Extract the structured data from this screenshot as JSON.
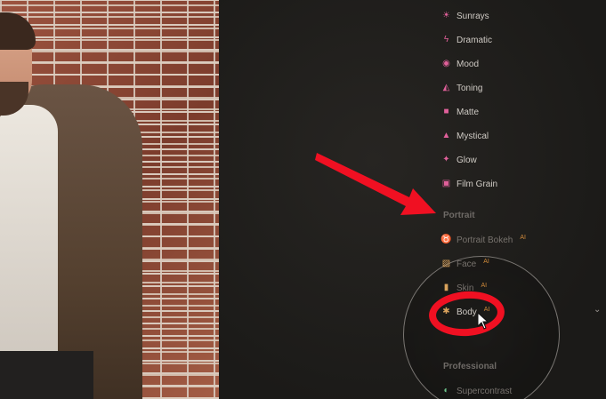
{
  "menu": {
    "items_top": [
      {
        "label": "Sunrays",
        "icon": "sunrays-icon",
        "color": "#e0609a"
      },
      {
        "label": "Dramatic",
        "icon": "dramatic-icon",
        "color": "#e0609a"
      },
      {
        "label": "Mood",
        "icon": "mood-icon",
        "color": "#e0609a"
      },
      {
        "label": "Toning",
        "icon": "toning-icon",
        "color": "#e0609a"
      },
      {
        "label": "Matte",
        "icon": "matte-icon",
        "color": "#e0609a"
      },
      {
        "label": "Mystical",
        "icon": "mystical-icon",
        "color": "#e0609a"
      },
      {
        "label": "Glow",
        "icon": "glow-icon",
        "color": "#e0609a"
      },
      {
        "label": "Film Grain",
        "icon": "film-grain-icon",
        "color": "#e0609a"
      }
    ],
    "portrait_section": "Portrait",
    "portrait_items": [
      {
        "label": "Portrait Bokeh",
        "icon": "portrait-bokeh-icon",
        "badge": "AI"
      },
      {
        "label": "Face",
        "icon": "face-icon",
        "badge": "AI"
      },
      {
        "label": "Skin",
        "icon": "skin-icon",
        "badge": "AI"
      },
      {
        "label": "Body",
        "icon": "body-icon",
        "badge": "AI"
      }
    ],
    "professional_section": "Professional",
    "professional_items": [
      {
        "label": "Supercontrast",
        "icon": "supercontrast-icon"
      }
    ]
  },
  "colors": {
    "accent_pink": "#e0609a",
    "ai_badge": "#d08a3a",
    "annotation_red": "#f01022",
    "section_text": "#6e6a66"
  }
}
